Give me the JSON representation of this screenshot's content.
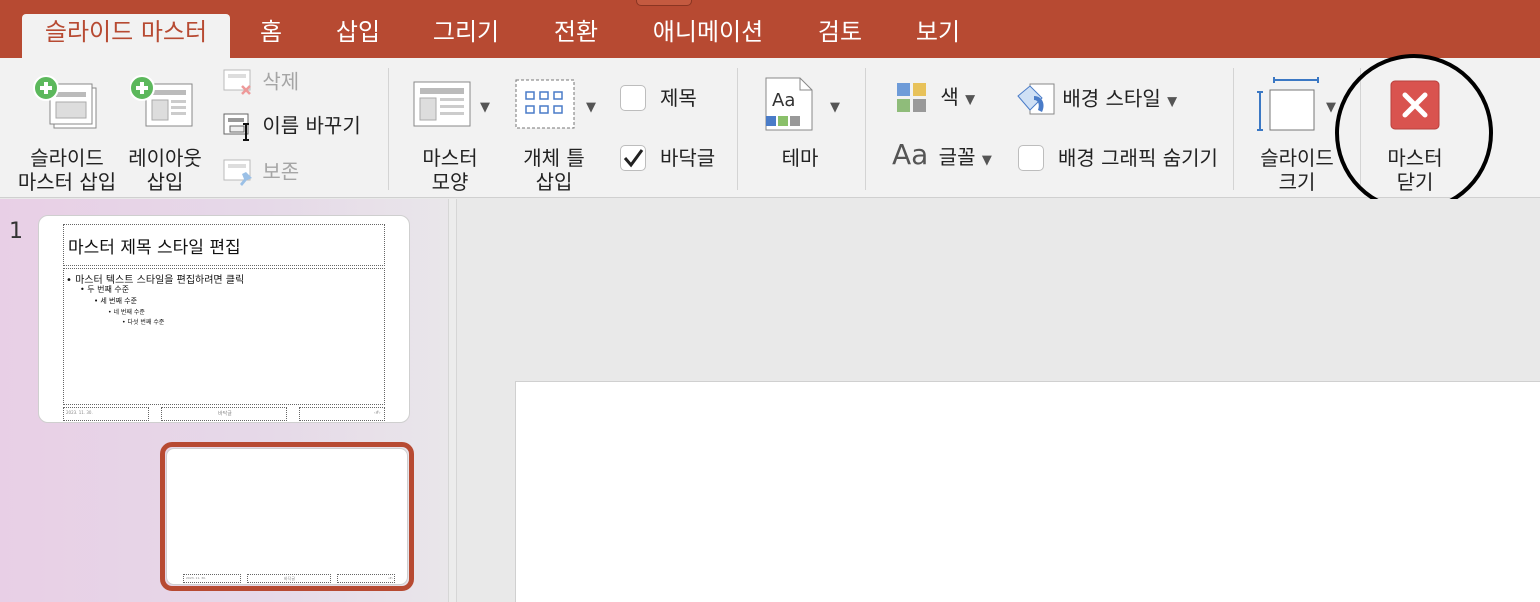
{
  "tabs": [
    {
      "label": "슬라이드 마스터",
      "active": true
    },
    {
      "label": "홈"
    },
    {
      "label": "삽입"
    },
    {
      "label": "그리기"
    },
    {
      "label": "전환"
    },
    {
      "label": "애니메이션"
    },
    {
      "label": "검토"
    },
    {
      "label": "보기"
    }
  ],
  "ribbon": {
    "insert_master": "슬라이드\n마스터 삽입",
    "insert_layout": "레이아웃\n삽입",
    "delete": "삭제",
    "rename": "이름 바꾸기",
    "preserve": "보존",
    "master_layout": "마스터\n모양",
    "insert_placeholder": "개체 틀\n삽입",
    "title_check": "제목",
    "footer_check": "바닥글",
    "themes": "테마",
    "colors": "색",
    "fonts": "글꼴",
    "background_styles": "배경 스타일",
    "hide_bg_graphics": "배경 그래픽 숨기기",
    "slide_size": "슬라이드\n크기",
    "close_master": "마스터\n닫기",
    "fonts_icon_text": "Aa",
    "theme_icon_text": "Aa"
  },
  "checkboxes": {
    "title": false,
    "footer": true,
    "hide_bg_graphics": false
  },
  "thumbnails": {
    "slide_number": "1",
    "master": {
      "title": "마스터 제목 스타일 편집",
      "levels": [
        "• 마스터 텍스트 스타일을 편집하려면 클릭",
        "• 두 번째 수준",
        "• 세 번째 수준",
        "• 네 번째 수준",
        "• 다섯 번째 수준"
      ],
      "footer_date": "2023. 11. 30.",
      "footer_text": "바닥글",
      "footer_num": "‹#›"
    },
    "layout": {
      "footer_date": "2023. 11. 30.",
      "footer_text": "바닥글",
      "footer_num": "‹#›"
    }
  },
  "colors": {
    "tab_bar": "#b74a32",
    "close_red": "#d9534f",
    "selected_border": "#b74a32"
  },
  "icons": [
    "insert-slide-master-icon",
    "insert-layout-icon",
    "delete-icon",
    "rename-icon",
    "preserve-icon",
    "master-layout-icon",
    "insert-placeholder-icon",
    "theme-icon",
    "color-swatch-icon",
    "fonts-icon",
    "background-styles-icon",
    "slide-size-icon",
    "close-icon",
    "checkmark-icon",
    "dropdown-caret-icon"
  ]
}
